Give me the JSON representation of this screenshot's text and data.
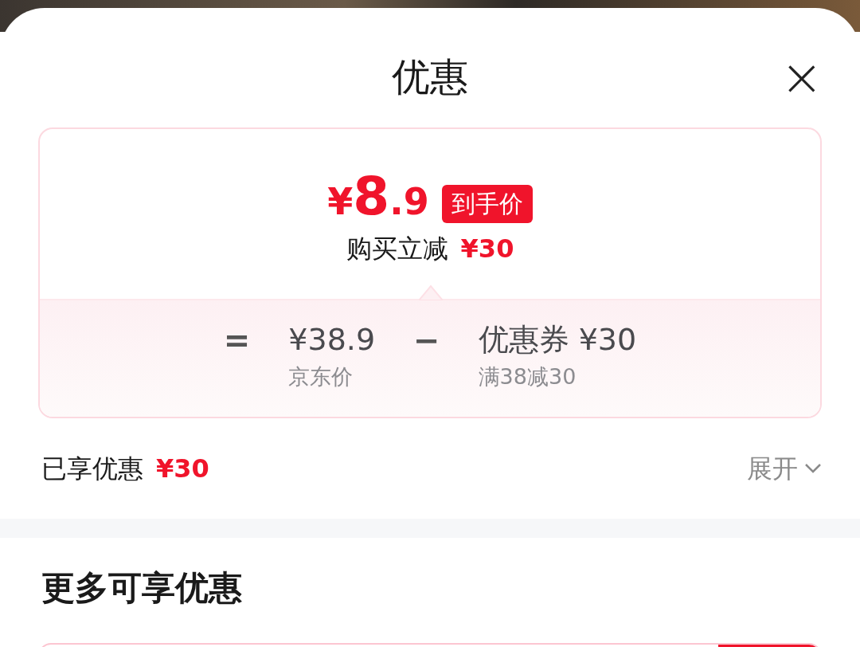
{
  "sheet": {
    "title": "优惠",
    "close": "×"
  },
  "price_card": {
    "price": {
      "currency": "¥",
      "integer": "8",
      "fraction": ".9"
    },
    "badge": "到手价",
    "instant_discount": {
      "label": "购买立减",
      "amount": "¥30"
    },
    "breakdown": [
      {
        "kind": "operator",
        "symbol": "="
      },
      {
        "kind": "term",
        "value": "¥38.9",
        "caption": "京东价"
      },
      {
        "kind": "operator",
        "symbol": "−"
      },
      {
        "kind": "term",
        "value": "优惠券 ¥30",
        "caption": "满38减30"
      }
    ]
  },
  "summary": {
    "label": "已享优惠",
    "amount": "¥30",
    "toggle": "展开",
    "expanded": false
  },
  "more_section": {
    "title": "更多可享优惠"
  }
}
